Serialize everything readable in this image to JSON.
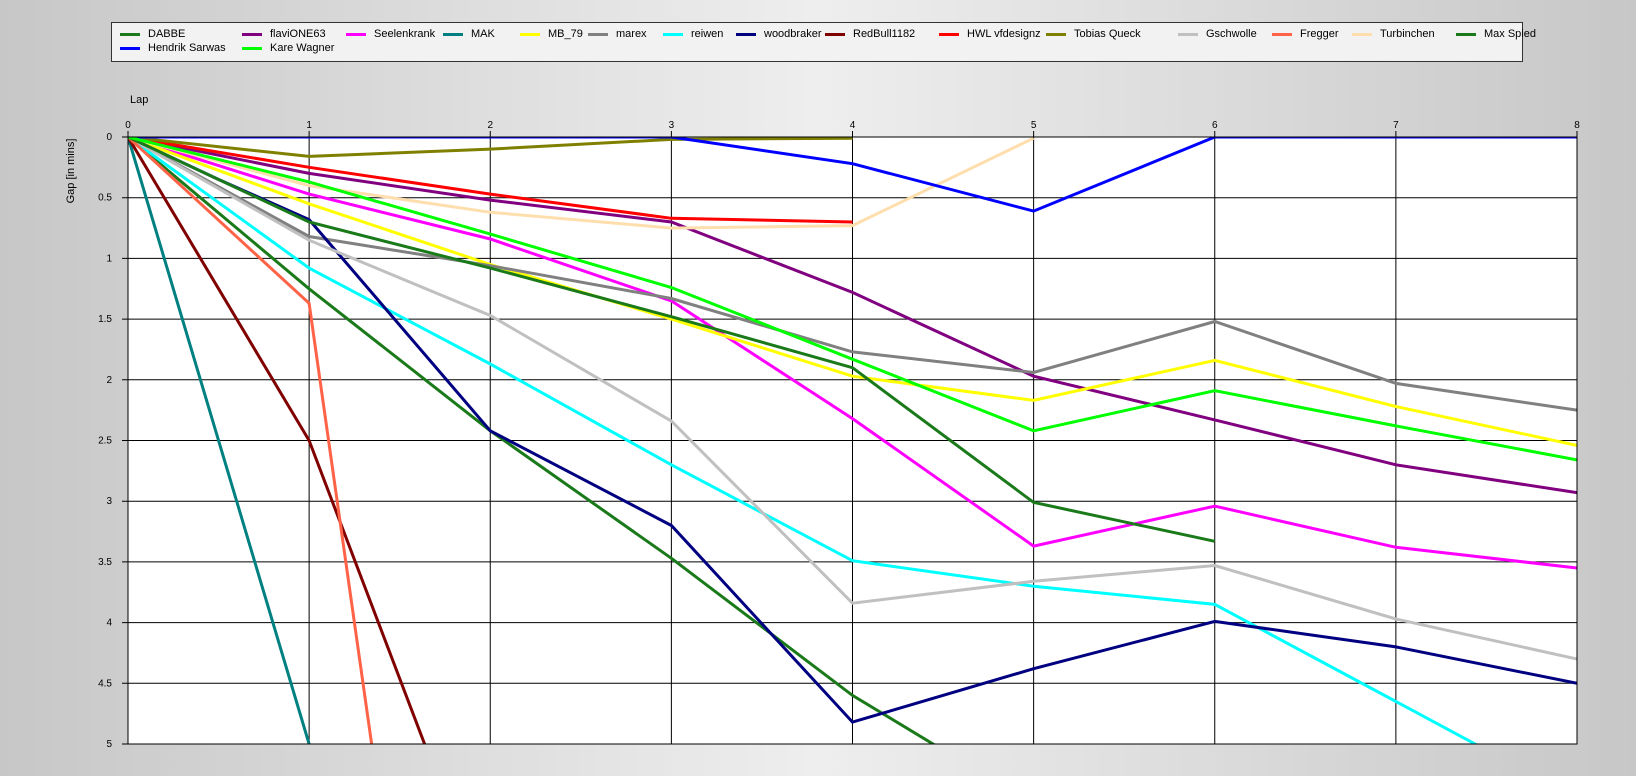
{
  "chart_data": {
    "type": "line",
    "xlabel": "Lap",
    "ylabel": "Gap [in mins]",
    "xlim": [
      0,
      8
    ],
    "ylim": [
      0,
      5
    ],
    "y_inverted": true,
    "grid": true,
    "legend_position": "top",
    "x_ticks": [
      "0",
      "1",
      "2",
      "3",
      "4",
      "5",
      "6",
      "7",
      "8"
    ],
    "y_ticks": [
      "0",
      "0.5",
      "1",
      "1.5",
      "2",
      "2.5",
      "3",
      "3.5",
      "4",
      "4.5",
      "5"
    ],
    "series": [
      {
        "name": "DABBE",
        "color": "#1a7a1a",
        "x": [
          0,
          1,
          2,
          3,
          4,
          5
        ],
        "y": [
          0,
          1.25,
          2.42,
          3.47,
          4.6,
          5.5
        ]
      },
      {
        "name": "flaviONE63",
        "color": "#800080",
        "x": [
          0,
          1,
          2,
          3,
          4,
          5,
          6,
          7,
          8
        ],
        "y": [
          0,
          0.3,
          0.52,
          0.7,
          1.28,
          1.97,
          2.33,
          2.7,
          2.93
        ]
      },
      {
        "name": "Seelenkrank",
        "color": "#ff00ff",
        "x": [
          0,
          1,
          2,
          3,
          4,
          5,
          6,
          7,
          8
        ],
        "y": [
          0,
          0.47,
          0.84,
          1.35,
          2.32,
          3.37,
          3.04,
          3.38,
          3.55
        ]
      },
      {
        "name": "MAK",
        "color": "#008080",
        "x": [
          0,
          1,
          1.05
        ],
        "y": [
          0,
          5,
          5.4
        ]
      },
      {
        "name": "MB_79",
        "color": "#ffff00",
        "x": [
          0,
          1,
          2,
          3,
          4,
          5,
          6,
          7,
          8
        ],
        "y": [
          0,
          0.55,
          1.05,
          1.5,
          1.97,
          2.17,
          1.84,
          2.22,
          2.54
        ]
      },
      {
        "name": "marex",
        "color": "#808080",
        "x": [
          0,
          1,
          2,
          3,
          4,
          5,
          6,
          7,
          8
        ],
        "y": [
          0,
          0.82,
          1.06,
          1.33,
          1.77,
          1.94,
          1.52,
          2.03,
          2.25
        ]
      },
      {
        "name": "reiwen",
        "color": "#00ffff",
        "x": [
          0,
          1,
          2,
          3,
          4,
          5,
          6,
          7,
          7.5
        ],
        "y": [
          0,
          1.08,
          1.87,
          2.7,
          3.49,
          3.7,
          3.85,
          4.65,
          5.05
        ]
      },
      {
        "name": "woodbraker",
        "color": "#000080",
        "x": [
          0,
          0.5,
          1,
          2,
          3,
          4,
          5,
          6,
          7,
          8
        ],
        "y": [
          0,
          0.35,
          0.68,
          2.42,
          3.2,
          4.82,
          4.38,
          3.99,
          4.2,
          4.5
        ]
      },
      {
        "name": "RedBull1182",
        "color": "#800000",
        "x": [
          0,
          1,
          1.65
        ],
        "y": [
          0,
          2.5,
          5.05
        ]
      },
      {
        "name": "HWL vfdesignz",
        "color": "#ff0000",
        "x": [
          0,
          1,
          2,
          3,
          4
        ],
        "y": [
          0,
          0.25,
          0.47,
          0.67,
          0.7
        ]
      },
      {
        "name": "Tobias Queck",
        "color": "#808000",
        "x": [
          0,
          1,
          2,
          3,
          4
        ],
        "y": [
          0,
          0.16,
          0.1,
          0.02,
          0.01
        ]
      },
      {
        "name": "Gschwolle",
        "color": "#c0c0c0",
        "x": [
          0,
          1,
          2,
          3,
          4,
          5,
          6,
          7,
          8
        ],
        "y": [
          0,
          0.85,
          1.47,
          2.34,
          3.84,
          3.66,
          3.53,
          3.97,
          4.3
        ]
      },
      {
        "name": "Fregger",
        "color": "#ff6347",
        "x": [
          0,
          1,
          1.35
        ],
        "y": [
          0,
          1.37,
          5.05
        ]
      },
      {
        "name": "Turbinchen",
        "color": "#ffdead",
        "x": [
          0,
          1,
          2,
          3,
          4,
          5
        ],
        "y": [
          0,
          0.4,
          0.62,
          0.75,
          0.73,
          0.01
        ]
      },
      {
        "name": "Max Spied",
        "color": "#1a7a1a",
        "x": [
          0,
          1,
          2,
          3,
          4,
          5,
          6
        ],
        "y": [
          0,
          0.7,
          1.08,
          1.48,
          1.9,
          3.01,
          3.33
        ]
      },
      {
        "name": "Hendrik Sarwas",
        "color": "#0000ff",
        "x": [
          0,
          1,
          2,
          3,
          4,
          5,
          6,
          7,
          8
        ],
        "y": [
          0,
          0,
          0,
          0,
          0.22,
          0.61,
          0,
          0,
          0
        ]
      },
      {
        "name": "Kare Wagner",
        "color": "#00ff00",
        "x": [
          0,
          1,
          2,
          3,
          4,
          5,
          6,
          7,
          8
        ],
        "y": [
          0,
          0.37,
          0.8,
          1.24,
          1.83,
          2.42,
          2.09,
          2.38,
          2.66
        ]
      }
    ]
  }
}
